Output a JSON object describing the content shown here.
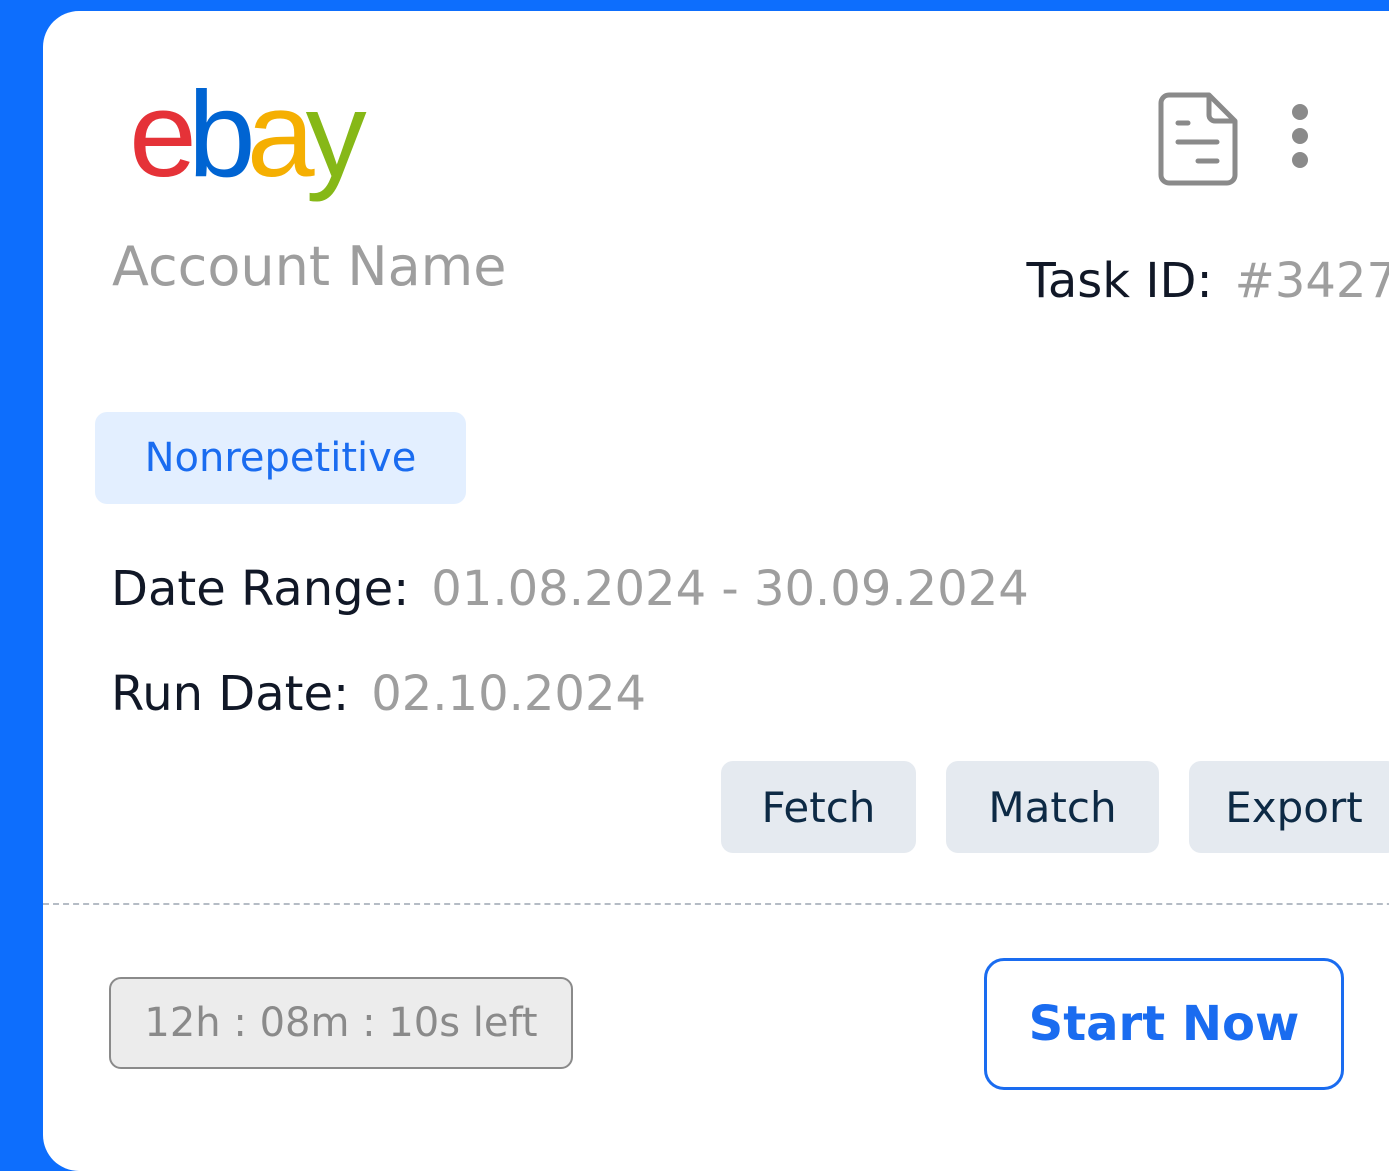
{
  "logo": {
    "letters": [
      "e",
      "b",
      "a",
      "y"
    ],
    "colors": [
      "#e53238",
      "#0064d2",
      "#f5af02",
      "#86b817"
    ]
  },
  "header": {
    "account_name": "Account Name",
    "task_id_label": "Task ID:",
    "task_id_value": "#3427",
    "icons": [
      "document-icon",
      "more-vertical-icon"
    ]
  },
  "tag": {
    "label": "Nonrepetitive"
  },
  "details": {
    "date_range_label": "Date Range:",
    "date_range_value": "01.08.2024 - 30.09.2024",
    "run_date_label": "Run Date:",
    "run_date_value": "02.10.2024"
  },
  "actions": {
    "fetch": "Fetch",
    "match": "Match",
    "export": "Export"
  },
  "footer": {
    "timer": "12h : 08m : 10s left",
    "start_label": "Start Now"
  },
  "colors": {
    "background": "#0d6efd",
    "accent": "#1a6cf0",
    "tag_bg": "#e3efff",
    "action_bg": "#e5eaf0",
    "muted_text": "#9e9e9e"
  }
}
